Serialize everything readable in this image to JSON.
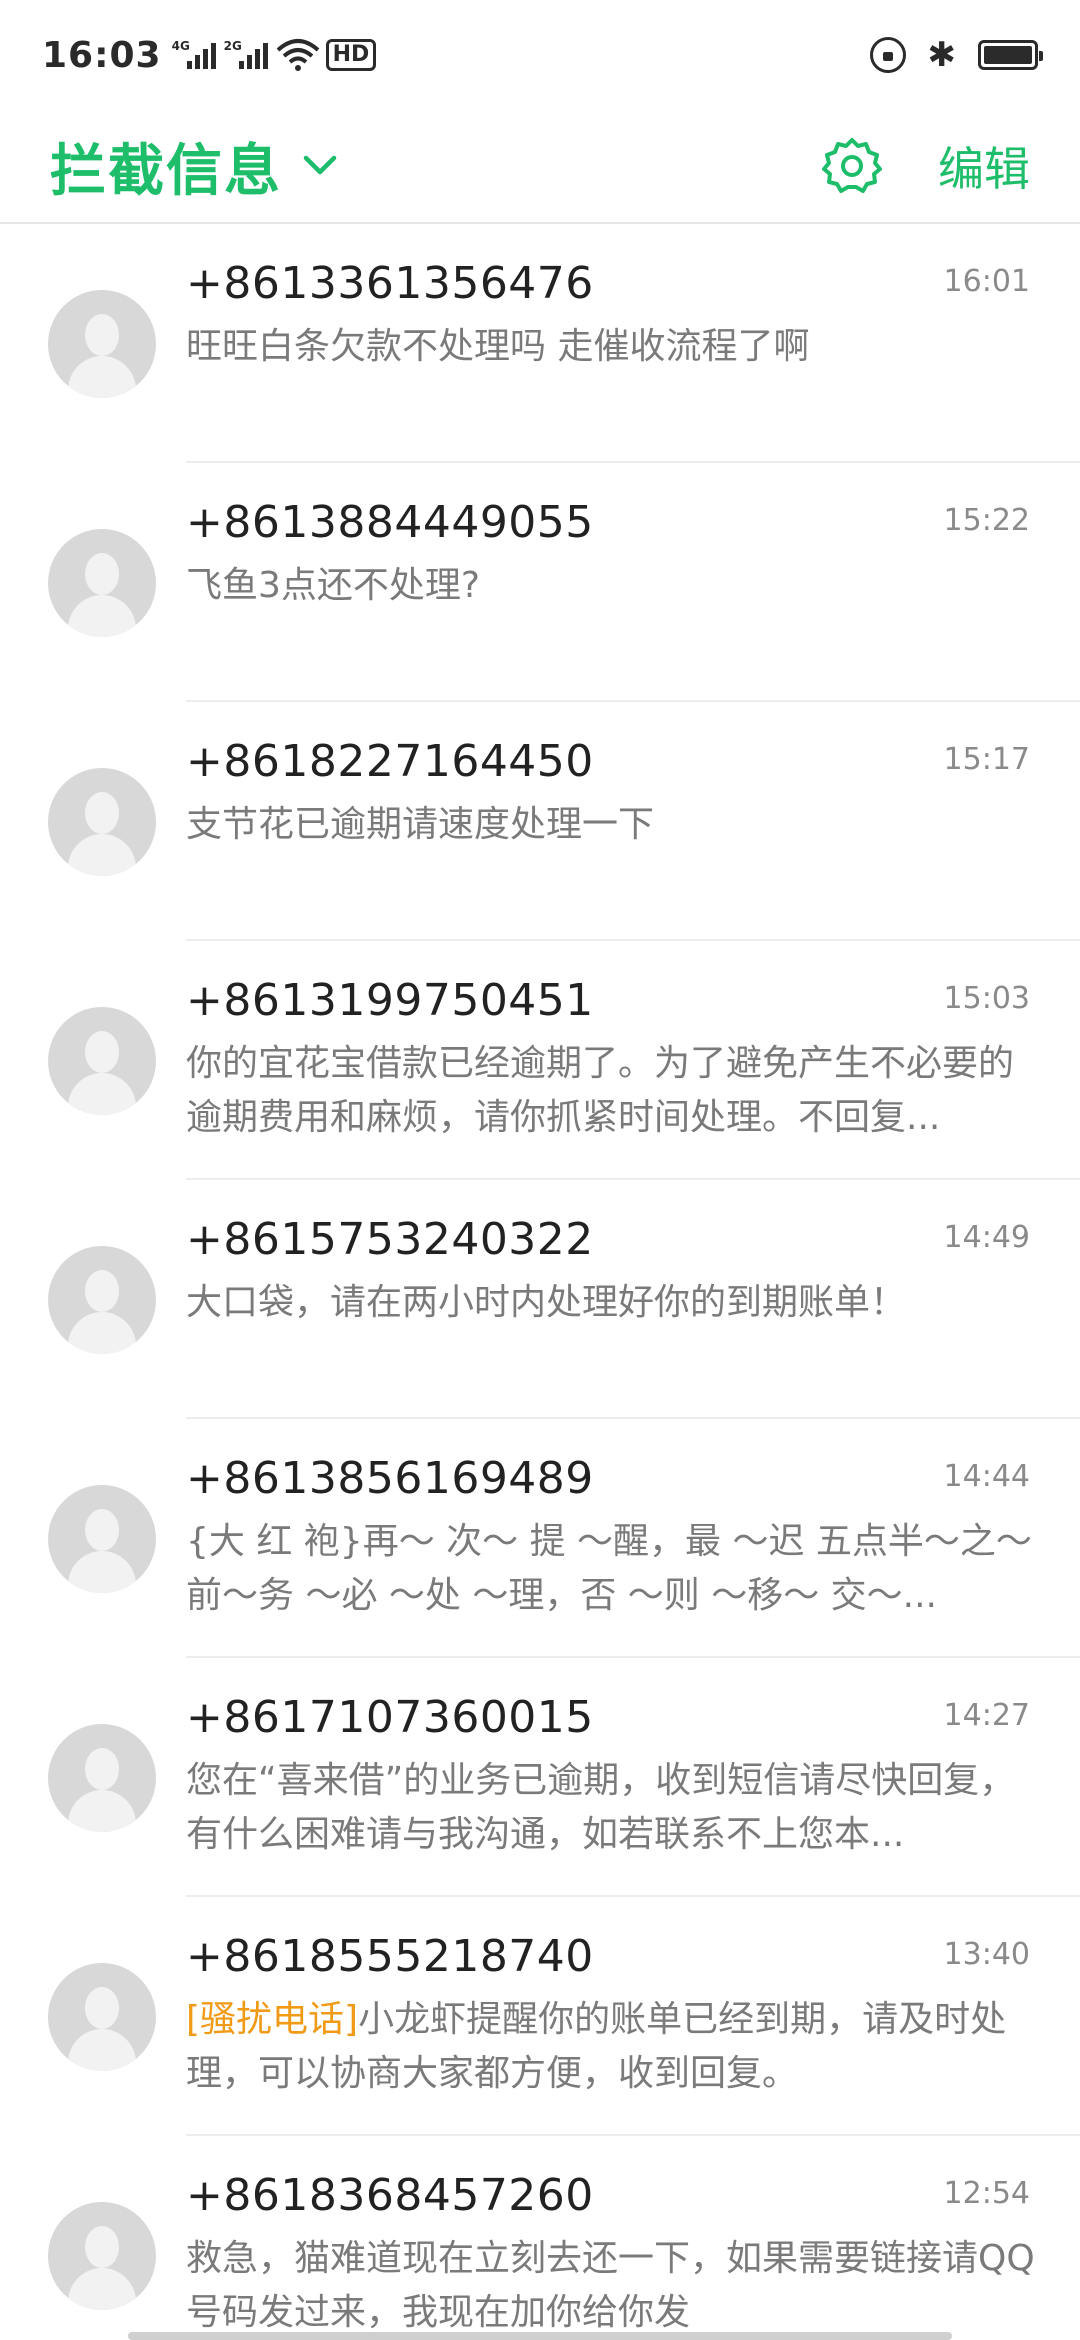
{
  "status_bar": {
    "time": "16:03",
    "sim1": "4G",
    "sim2": "2G",
    "hd_label": "HD",
    "bluetooth": "✱"
  },
  "header": {
    "title": "拦截信息",
    "edit_label": "编辑",
    "accent_color": "#1dbd6a"
  },
  "messages": [
    {
      "sender": "+8613361356476",
      "time": "16:01",
      "tag": "",
      "preview": "旺旺白条欠款不处理吗  走催收流程了啊"
    },
    {
      "sender": "+8613884449055",
      "time": "15:22",
      "tag": "",
      "preview": "飞鱼3点还不处理?"
    },
    {
      "sender": "+8618227164450",
      "time": "15:17",
      "tag": "",
      "preview": "支节花已逾期请速度处理一下"
    },
    {
      "sender": "+8613199750451",
      "time": "15:03",
      "tag": "",
      "preview": "你的宜花宝借款已经逾期了。为了避免产生不必要的逾期费用和麻烦，请你抓紧时间处理。不回复..."
    },
    {
      "sender": "+8615753240322",
      "time": "14:49",
      "tag": "",
      "preview": "大口袋，请在两小时内处理好你的到期账单！"
    },
    {
      "sender": "+8613856169489",
      "time": "14:44",
      "tag": "",
      "preview": "{大 红 袍}再～ 次～ 提 ～醒，最 ～迟 五点半～之～前～务 ～必 ～处 ～理，否 ～则 ～移～ 交～..."
    },
    {
      "sender": "+8617107360015",
      "time": "14:27",
      "tag": "",
      "preview": "您在“喜来借”的业务已逾期，收到短信请尽快回复，有什么困难请与我沟通，如若联系不上您本..."
    },
    {
      "sender": "+8618555218740",
      "time": "13:40",
      "tag": "[骚扰电话]",
      "preview": "小龙虾提醒你的账单已经到期，请及时处理，可以协商大家都方便，收到回复。"
    },
    {
      "sender": "+8618368457260",
      "time": "12:54",
      "tag": "",
      "preview": "救急，猫难道现在立刻去还一下，如果需要链接请QQ号码发过来，我现在加你给你发"
    }
  ]
}
